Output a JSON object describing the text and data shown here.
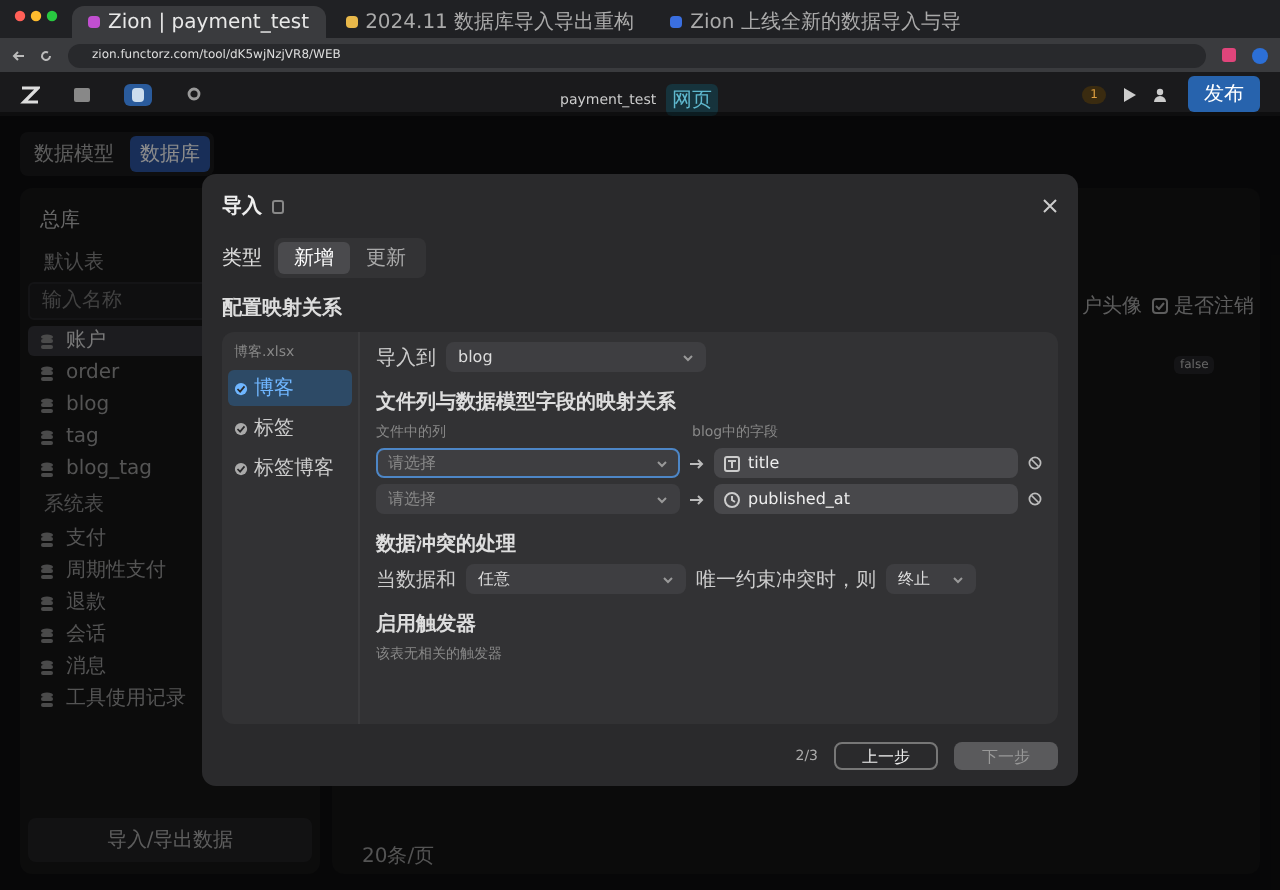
{
  "browser": {
    "tabs": [
      {
        "title": "Zion | payment_test",
        "selected": true
      },
      {
        "title": "2024.11 数据库导入导出重构",
        "selected": false
      },
      {
        "title": "Zion 上线全新的数据导入与导",
        "selected": false
      }
    ],
    "address": "zion.functorz.com/tool/dK5wjNzjVR8/WEB"
  },
  "toolbar": {
    "project": "payment_test",
    "badge": "网页",
    "warnings": "1",
    "publish": "发布"
  },
  "page": {
    "view_tabs": [
      {
        "label": "数据模型",
        "selected": false
      },
      {
        "label": "数据库",
        "selected": true
      }
    ],
    "sidebar": {
      "title": "总库",
      "group": "默认表",
      "search_placeholder": "输入名称",
      "tables": [
        {
          "name": "账户",
          "selected": true
        },
        {
          "name": "order",
          "selected": false
        },
        {
          "name": "blog",
          "selected": false
        },
        {
          "name": "tag",
          "selected": false
        },
        {
          "name": "blog_tag",
          "selected": false
        }
      ],
      "system_group": "系统表",
      "system_tables": [
        "支付",
        "周期性支付",
        "退款",
        "会话",
        "消息",
        "工具使用记录"
      ],
      "import_export": "导入/导出数据"
    },
    "table": {
      "columns": [
        "户头像",
        "是否注销"
      ],
      "cell": "false",
      "page_size": "20条/页"
    }
  },
  "modal": {
    "title": "导入",
    "type_label": "类型",
    "types": [
      {
        "label": "新增",
        "selected": true
      },
      {
        "label": "更新",
        "selected": false
      }
    ],
    "mapping_title": "配置映射关系",
    "file": "博客.xlsx",
    "sheets": [
      {
        "label": "博客",
        "selected": true
      },
      {
        "label": "标签",
        "selected": false
      },
      {
        "label": "标签博客",
        "selected": false
      }
    ],
    "import_to_label": "导入到",
    "import_to": "blog",
    "mapping_heading": "文件列与数据模型字段的映射关系",
    "file_col_label": "文件中的列",
    "field_col_label": "blog中的字段",
    "mappings": [
      {
        "placeholder": "请选择",
        "field": "title",
        "kind": "text",
        "focused": true
      },
      {
        "placeholder": "请选择",
        "field": "published_at",
        "kind": "time",
        "focused": false
      }
    ],
    "conflict_title": "数据冲突的处理",
    "conflict_prefix": "当数据和",
    "conflict_value": "任意",
    "conflict_middle": "唯一约束冲突时，则",
    "conflict_action": "终止",
    "trigger_title": "启用触发器",
    "trigger_note": "该表无相关的触发器",
    "step": "2/3",
    "prev": "上一步",
    "next": {
      "label": "下一步",
      "disabled": true
    }
  }
}
